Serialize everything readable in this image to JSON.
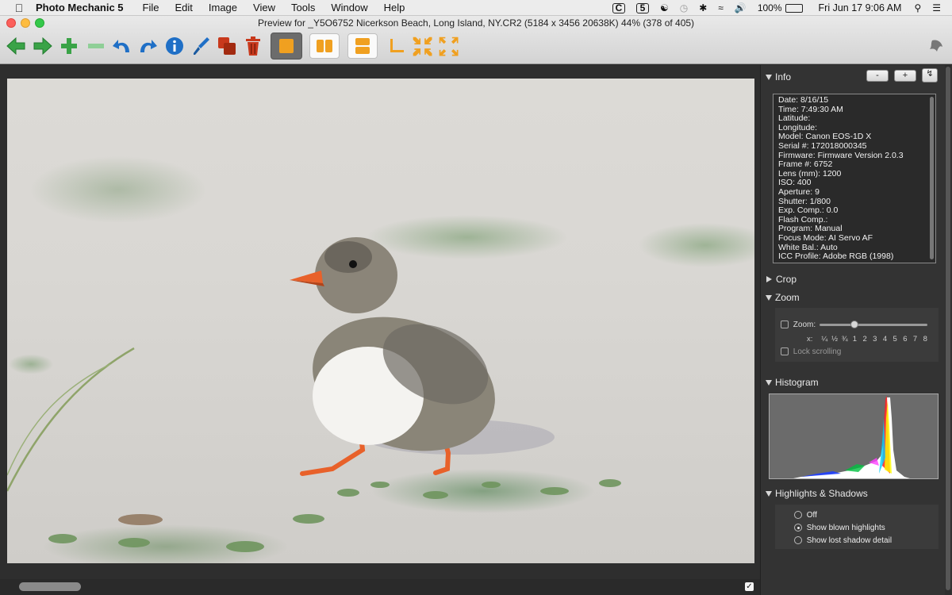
{
  "menubar": {
    "app_name": "Photo Mechanic 5",
    "items": [
      "File",
      "Edit",
      "Image",
      "View",
      "Tools",
      "Window",
      "Help"
    ],
    "battery": "100%",
    "clock": "Fri Jun 17  9:06 AM"
  },
  "window": {
    "title": "Preview for _Y5O6752 Nicerkson Beach, Long Island, NY.CR2 (5184 x 3456 20638K) 44% (378 of 405)"
  },
  "toolbar": {
    "buttons": [
      "prev-arrow-icon",
      "next-arrow-icon",
      "add-icon",
      "remove-icon",
      "rotate-left-icon",
      "rotate-right-icon",
      "info-icon",
      "edit-brush-icon",
      "copy-icon",
      "trash-icon",
      "single-view-icon",
      "side-by-side-icon",
      "stacked-view-icon",
      "crop-icon",
      "shrink-icon",
      "expand-icon"
    ]
  },
  "colors": {
    "accent_green": "#3aa347",
    "accent_blue": "#1f6fc6",
    "accent_orange": "#f0a020",
    "trash_red": "#c8391c"
  },
  "panel": {
    "info": {
      "title": "Info",
      "minus_label": "-",
      "plus_label": "+",
      "lines": [
        "Date: 8/16/15",
        "Time: 7:49:30 AM",
        "Latitude:",
        "Longitude:",
        "Model: Canon EOS-1D X",
        "Serial #: 172018000345",
        "Firmware: Firmware Version 2.0.3",
        "Frame #: 6752",
        "Lens (mm): 1200",
        "ISO: 400",
        "Aperture: 9",
        "Shutter: 1/800",
        "Exp. Comp.: 0.0",
        "Flash Comp.:",
        "Program: Manual",
        "Focus Mode: AI Servo AF",
        "White Bal.: Auto",
        "ICC Profile: Adobe RGB (1998)"
      ]
    },
    "crop": {
      "title": "Crop"
    },
    "zoom": {
      "title": "Zoom",
      "zoom_label": "Zoom:",
      "scale_prefix": "x:",
      "scale_values": [
        "¼",
        "½",
        "¾",
        "1",
        "2",
        "3",
        "4",
        "5",
        "6",
        "7",
        "8"
      ],
      "slider_fraction": 0.31,
      "lock_label": "Lock scrolling"
    },
    "histogram": {
      "title": "Histogram"
    },
    "highlights": {
      "title": "Highlights & Shadows",
      "options": [
        "Off",
        "Show blown highlights",
        "Show lost shadow detail"
      ],
      "selected": "Show blown highlights"
    }
  }
}
